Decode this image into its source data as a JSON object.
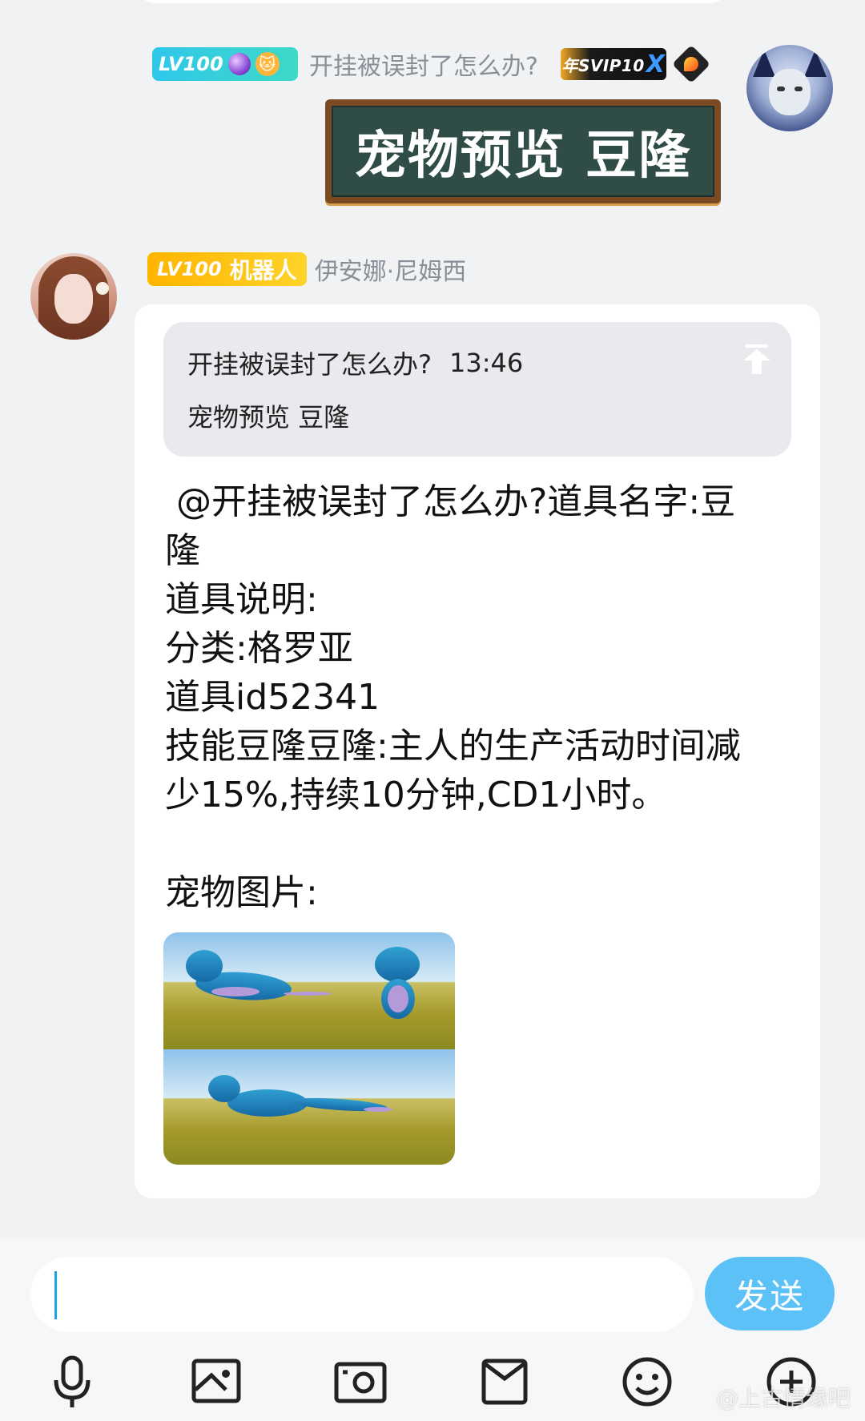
{
  "self_message": {
    "level_badge": "LV100",
    "sender_name": "开挂被误封了怎么办?",
    "vip_badge": "年SVIP10",
    "vip_badge_suffix": "X",
    "board_text": "宠物预览 豆隆"
  },
  "bot_message": {
    "level_badge": "LV100",
    "role_badge": "机器人",
    "sender_name": "伊安娜·尼姆西",
    "quote": {
      "author": "开挂被误封了怎么办?",
      "time": "13:46",
      "text": "宠物预览 豆隆"
    },
    "lines": [
      " @开挂被误封了怎么办?道具名字:豆",
      "隆",
      "道具说明:",
      "分类:格罗亚",
      "道具id52341",
      "技能豆隆豆隆:主人的生产活动时间减",
      "少15%,持续10分钟,CD1小时。",
      "",
      "宠物图片:"
    ]
  },
  "input_bar": {
    "placeholder": "",
    "send_label": "发送",
    "tools": [
      "microphone-icon",
      "image-icon",
      "camera-icon",
      "envelope-icon",
      "emoji-icon",
      "plus-icon"
    ]
  },
  "watermark": "@上古情缘吧",
  "colors": {
    "send_button": "#5cc1f6",
    "level_blue": "#2fc7ea",
    "level_gold": "#ffb400",
    "board_green": "#2f4c46",
    "caret": "#1aa3e8"
  }
}
